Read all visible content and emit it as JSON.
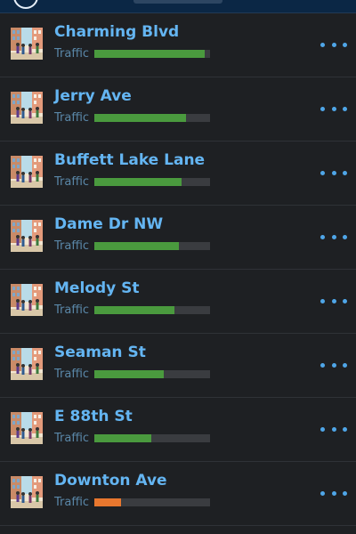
{
  "colors": {
    "accent": "#64b5f2",
    "traffic_good": "#4a9a3e",
    "traffic_low": "#e8772e",
    "bar_track": "#3a3c40"
  },
  "streets": [
    {
      "name": "Charming Blvd",
      "traffic_label": "Traffic",
      "traffic": 0.95,
      "status": "good",
      "icon": "street-scene-icon",
      "menu_icon": "more-options-icon"
    },
    {
      "name": "Jerry Ave",
      "traffic_label": "Traffic",
      "traffic": 0.79,
      "status": "good",
      "icon": "street-scene-icon",
      "menu_icon": "more-options-icon"
    },
    {
      "name": "Buffett Lake Lane",
      "traffic_label": "Traffic",
      "traffic": 0.75,
      "status": "good",
      "icon": "street-scene-icon",
      "menu_icon": "more-options-icon"
    },
    {
      "name": "Dame Dr NW",
      "traffic_label": "Traffic",
      "traffic": 0.73,
      "status": "good",
      "icon": "street-scene-icon",
      "menu_icon": "more-options-icon"
    },
    {
      "name": "Melody St",
      "traffic_label": "Traffic",
      "traffic": 0.69,
      "status": "good",
      "icon": "street-scene-icon",
      "menu_icon": "more-options-icon"
    },
    {
      "name": "Seaman St",
      "traffic_label": "Traffic",
      "traffic": 0.6,
      "status": "good",
      "icon": "street-scene-icon",
      "menu_icon": "more-options-icon"
    },
    {
      "name": "E 88th St",
      "traffic_label": "Traffic",
      "traffic": 0.49,
      "status": "good",
      "icon": "street-scene-icon",
      "menu_icon": "more-options-icon"
    },
    {
      "name": "Downton Ave",
      "traffic_label": "Traffic",
      "traffic": 0.23,
      "status": "low",
      "icon": "street-scene-icon",
      "menu_icon": "more-options-icon"
    }
  ]
}
